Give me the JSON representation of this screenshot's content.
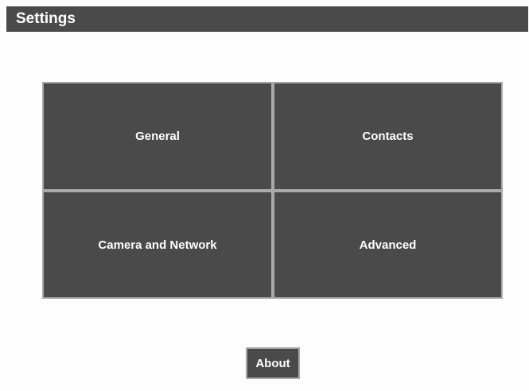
{
  "header": {
    "title": "Settings"
  },
  "tiles": [
    {
      "label": "General"
    },
    {
      "label": "Contacts"
    },
    {
      "label": "Camera and Network"
    },
    {
      "label": "Advanced"
    }
  ],
  "footer": {
    "about_label": "About"
  },
  "colors": {
    "tile_background": "#4a4a4a",
    "tile_border": "#a9a9a9",
    "page_background": "#fdfdfd",
    "text": "#ffffff"
  }
}
